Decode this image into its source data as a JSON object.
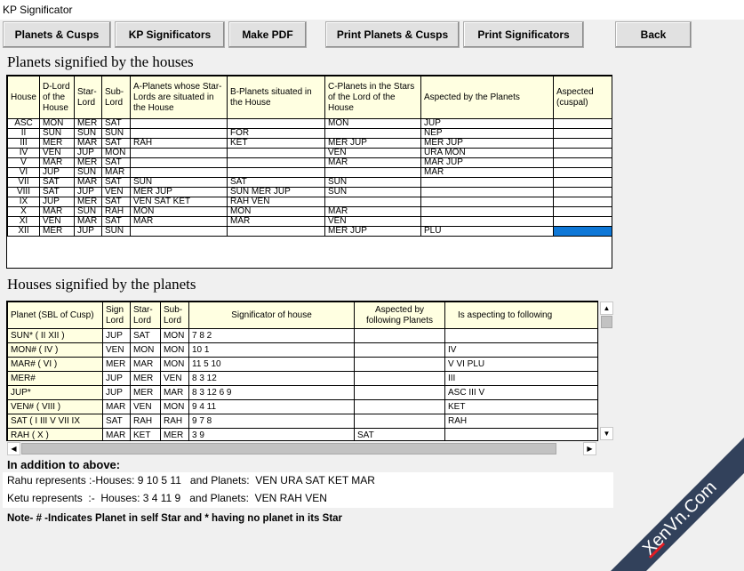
{
  "window": {
    "title": "KP Significator"
  },
  "toolbar": {
    "planets_cusps": "Planets & Cusps",
    "kp_significators": "KP Significators",
    "make_pdf": "Make PDF",
    "print_planets_cusps": "Print Planets & Cusps",
    "print_significators": "Print  Significators",
    "back": "Back"
  },
  "houses_section": {
    "title": "Planets signified by the houses",
    "headers": [
      "House",
      "D-Lord of the House",
      "Star-Lord",
      "Sub-Lord",
      "A-Planets whose Star-Lords are situated in the House",
      "B-Planets situated in the House",
      "C-Planets in the Stars of the Lord of the House",
      "Aspected by the Planets",
      "Aspected (cuspal)"
    ],
    "rows": [
      [
        "ASC",
        "MON",
        "MER",
        "SAT",
        "",
        "",
        "MON",
        "JUP",
        ""
      ],
      [
        "II",
        "SUN",
        "SUN",
        "SUN",
        "",
        "FOR",
        "",
        "NEP",
        ""
      ],
      [
        "III",
        "MER",
        "MAR",
        "SAT",
        "RAH",
        "KET",
        "MER JUP",
        "MER JUP",
        ""
      ],
      [
        "IV",
        "VEN",
        "JUP",
        "MON",
        "",
        "",
        "VEN",
        "URA MON",
        ""
      ],
      [
        "V",
        "MAR",
        "MER",
        "SAT",
        "",
        "",
        "MAR",
        "MAR JUP",
        ""
      ],
      [
        "VI",
        "JUP",
        "SUN",
        "MAR",
        "",
        "",
        "",
        "MAR",
        ""
      ],
      [
        "VII",
        "SAT",
        "MAR",
        "SAT",
        "SUN",
        "SAT",
        "SUN",
        "",
        ""
      ],
      [
        "VIII",
        "SAT",
        "JUP",
        "VEN",
        "MER JUP",
        "SUN MER JUP",
        "SUN",
        "",
        ""
      ],
      [
        "IX",
        "JUP",
        "MER",
        "SAT",
        "VEN SAT KET",
        "RAH VEN",
        "",
        "",
        ""
      ],
      [
        "X",
        "MAR",
        "SUN",
        "RAH",
        "MON",
        "MON",
        "MAR",
        "",
        ""
      ],
      [
        "XI",
        "VEN",
        "MAR",
        "SAT",
        "MAR",
        "MAR",
        "VEN",
        "",
        ""
      ],
      [
        "XII",
        "MER",
        "JUP",
        "SUN",
        "",
        "",
        "MER JUP",
        "PLU",
        ""
      ]
    ]
  },
  "planets_section": {
    "title": "Houses signified by the planets",
    "headers": [
      "Planet (SBL of Cusp)",
      "Sign Lord",
      "Star-Lord",
      "Sub-Lord",
      "Significator of house",
      "Aspected by following Planets",
      "Is aspecting to following"
    ],
    "rows": [
      [
        "SUN* ( II  XII )",
        "JUP",
        "SAT",
        "MON",
        "7  8  2",
        "",
        ""
      ],
      [
        "MON# ( IV )",
        "VEN",
        "MON",
        "MON",
        "10  1",
        "",
        "IV"
      ],
      [
        "MAR# ( VI )",
        "MER",
        "MAR",
        "MON",
        "11  5  10",
        "",
        "V  VI  PLU"
      ],
      [
        "MER#",
        "JUP",
        "MER",
        "VEN",
        "8  3  12",
        "",
        "III"
      ],
      [
        "JUP*",
        "JUP",
        "MER",
        "MAR",
        "8  3  12  6  9",
        "",
        "ASC III  V"
      ],
      [
        "VEN# ( VIII )",
        "MAR",
        "VEN",
        "MON",
        "9  4  11",
        "",
        "KET"
      ],
      [
        "SAT ( I  III  V  VII  IX",
        "SAT",
        "RAH",
        "RAH",
        "9  7  8",
        "",
        "RAH"
      ],
      [
        "RAH ( X )",
        "MAR",
        "KET",
        "MER",
        "3  9",
        "SAT",
        ""
      ]
    ]
  },
  "scroll_glyphs": {
    "up": "▲",
    "down": "▼",
    "left": "◀",
    "right": "▶"
  },
  "addition": {
    "heading": "In addition to above:",
    "rahu": "Rahu represents :-Houses: 9 10 5 11   and Planets:  VEN URA SAT KET MAR",
    "ketu": "Ketu represents  :-  Houses: 3 4 11 9   and Planets:  VEN RAH VEN"
  },
  "note": "Note- # -Indicates Planet in self Star and * having no planet in its Star",
  "watermark": {
    "text": "XenVn.Com",
    "colors": {
      "band": "#1d2d4a",
      "accent": "#e21b23"
    }
  }
}
